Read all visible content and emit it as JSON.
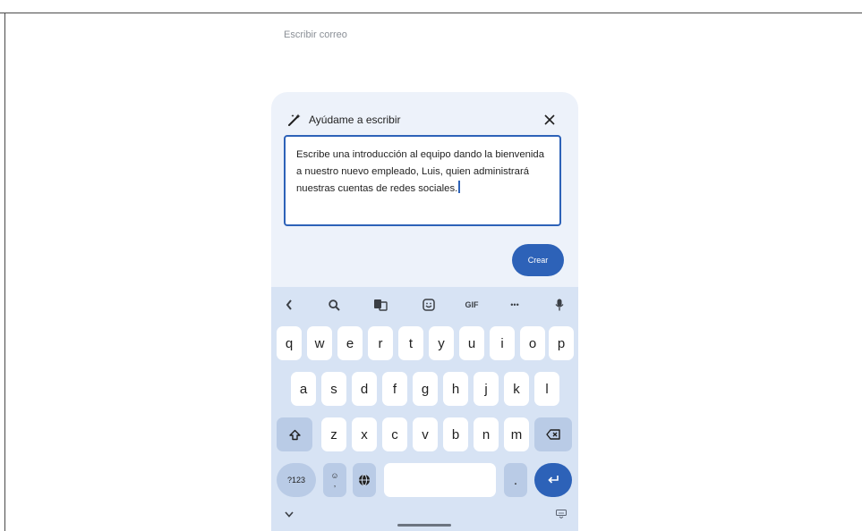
{
  "compose": {
    "placeholder": "Escribir correo"
  },
  "helper": {
    "title": "Ayúdame a escribir",
    "prompt_text": "Escribe una introducción al equipo dando la bienvenida a nuestro nuevo empleado, Luis, quien administrará nuestras cuentas de redes sociales.",
    "create_label": "Crear",
    "icons": {
      "title_icon": "magic-wand-icon",
      "close_icon": "close-icon"
    }
  },
  "keyboard": {
    "toolbar": {
      "gif_label": "GIF",
      "more_label": "•••",
      "icons": [
        "chevron-left-icon",
        "search-icon",
        "translate-icon",
        "sticker-icon",
        "more-icon",
        "mic-icon"
      ]
    },
    "rows": [
      [
        "q",
        "w",
        "e",
        "r",
        "t",
        "y",
        "u",
        "i",
        "o",
        "p"
      ],
      [
        "a",
        "s",
        "d",
        "f",
        "g",
        "h",
        "j",
        "k",
        "l"
      ],
      [
        "z",
        "x",
        "c",
        "v",
        "b",
        "n",
        "m"
      ]
    ],
    "symbols_label": "?123",
    "period_label": ".",
    "emoji_label": "☺",
    "emoji_sub_label": ",",
    "colors": {
      "accent": "#2d62b8",
      "keyboard_bg": "#d7e3f4",
      "sheet_bg": "#edf2fa"
    }
  }
}
